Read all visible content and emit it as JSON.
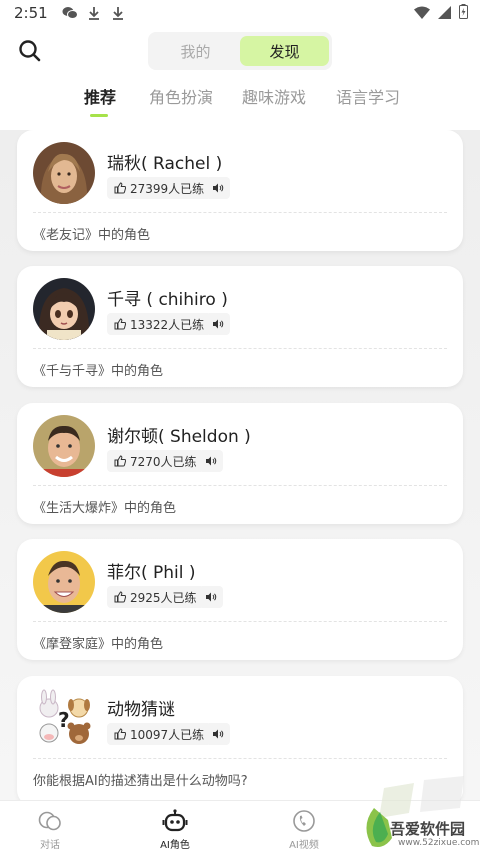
{
  "status_bar": {
    "time": "2:51"
  },
  "header": {
    "segments": [
      "我的",
      "发现"
    ],
    "active_segment": "发现",
    "tabs": [
      "推荐",
      "角色扮演",
      "趣味游戏",
      "语言学习"
    ],
    "active_tab": "推荐"
  },
  "cards": [
    {
      "name": "瑞秋( Rachel )",
      "likes": "27399人已练",
      "desc": "《老友记》中的角色"
    },
    {
      "name": "千寻 ( chihiro )",
      "likes": "13322人已练",
      "desc": "《千与千寻》中的角色"
    },
    {
      "name": "谢尔顿( Sheldon )",
      "likes": "7270人已练",
      "desc": "《生活大爆炸》中的角色"
    },
    {
      "name": "菲尔( Phil )",
      "likes": "2925人已练",
      "desc": "《摩登家庭》中的角色"
    },
    {
      "name": "动物猜谜",
      "likes": "10097人已练",
      "desc": "你能根据AI的描述猜出是什么动物吗?"
    }
  ],
  "bottom_nav": [
    {
      "label": "对话",
      "icon": "chat-bubbles-icon"
    },
    {
      "label": "AI角色",
      "icon": "robot-icon"
    },
    {
      "label": "AI视频",
      "icon": "video-call-icon"
    }
  ],
  "watermark": {
    "text": "吾爱软件园",
    "url": "www.52zixue.com"
  },
  "colors": {
    "accent": "#a6e24a",
    "segment_active": "#d6f5a3"
  }
}
